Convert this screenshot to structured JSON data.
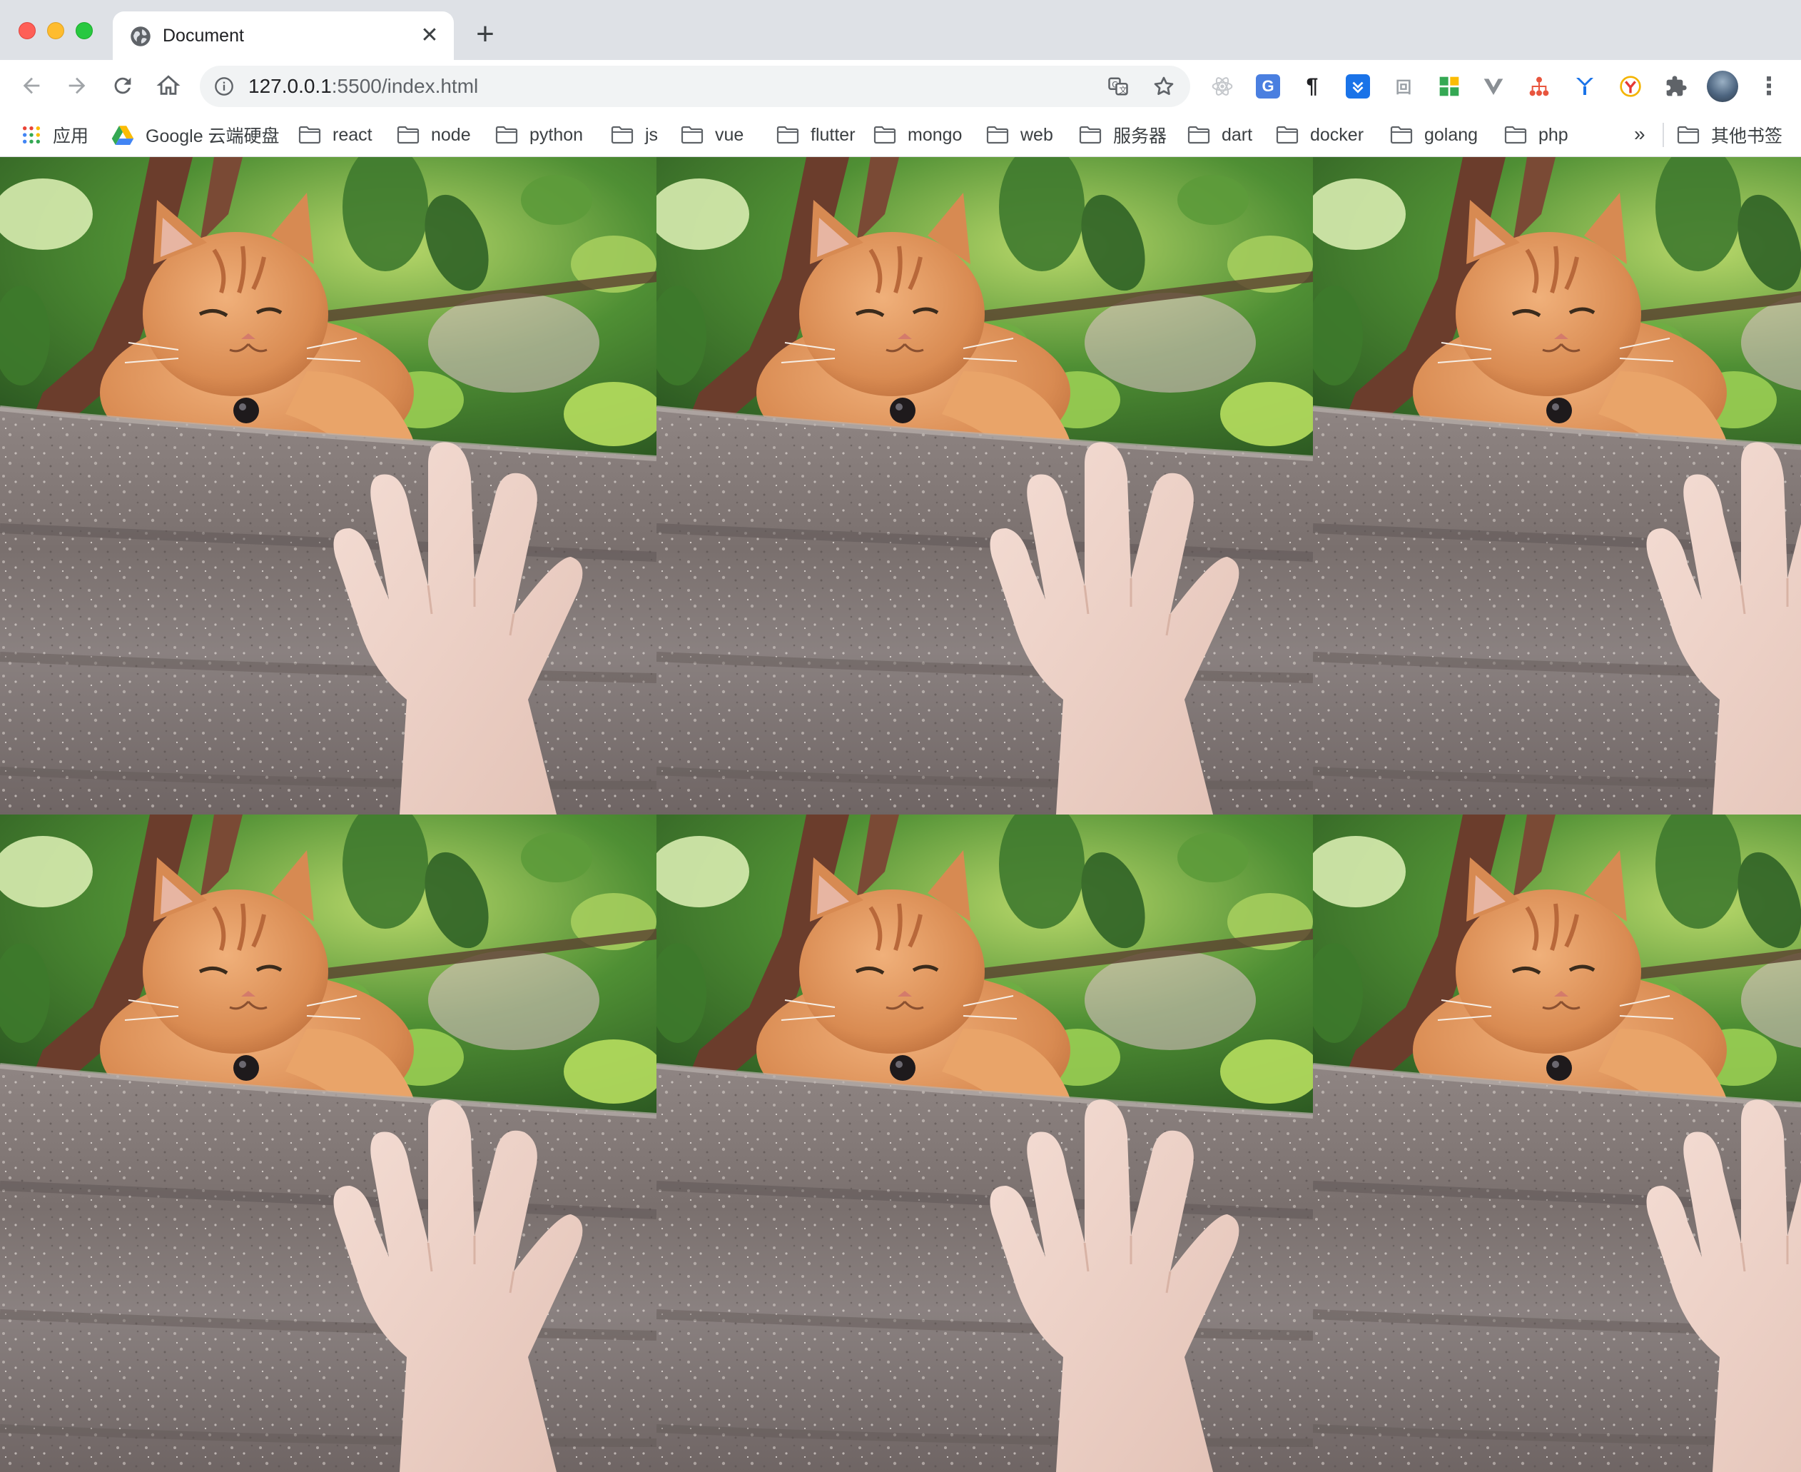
{
  "window": {
    "tab_title": "Document",
    "tab_icon": "globe-icon"
  },
  "toolbar": {
    "url_host": "127.0.0.1",
    "url_rest": ":5500/index.html"
  },
  "bookmarks": {
    "apps_label": "应用",
    "items": [
      {
        "label": "Google 云端硬盘",
        "icon": "google-drive-icon"
      },
      {
        "label": "react",
        "icon": "folder-icon"
      },
      {
        "label": "node",
        "icon": "folder-icon"
      },
      {
        "label": "python",
        "icon": "folder-icon"
      },
      {
        "label": "js",
        "icon": "folder-icon"
      },
      {
        "label": "vue",
        "icon": "folder-icon"
      },
      {
        "label": "flutter",
        "icon": "folder-icon"
      },
      {
        "label": "mongo",
        "icon": "folder-icon"
      },
      {
        "label": "web",
        "icon": "folder-icon"
      },
      {
        "label": "服务器",
        "icon": "folder-icon"
      },
      {
        "label": "dart",
        "icon": "folder-icon"
      },
      {
        "label": "docker",
        "icon": "folder-icon"
      },
      {
        "label": "golang",
        "icon": "folder-icon"
      },
      {
        "label": "php",
        "icon": "folder-icon"
      }
    ],
    "overflow": "»",
    "other_label": "其他书签"
  },
  "page": {
    "tiles": [
      {
        "subject": "orange cat reaching paw toward hand over stone wall"
      },
      {
        "subject": "orange cat reaching paw toward hand over stone wall"
      },
      {
        "subject": "orange cat reaching paw toward hand over stone wall"
      },
      {
        "subject": "orange cat reaching paw toward hand over stone wall"
      },
      {
        "subject": "orange cat reaching paw toward hand over stone wall"
      },
      {
        "subject": "orange cat reaching paw toward hand over stone wall"
      }
    ]
  },
  "colors": {
    "titlebar": "#dee1e6",
    "omnibox": "#f1f3f4",
    "text": "#202124"
  }
}
